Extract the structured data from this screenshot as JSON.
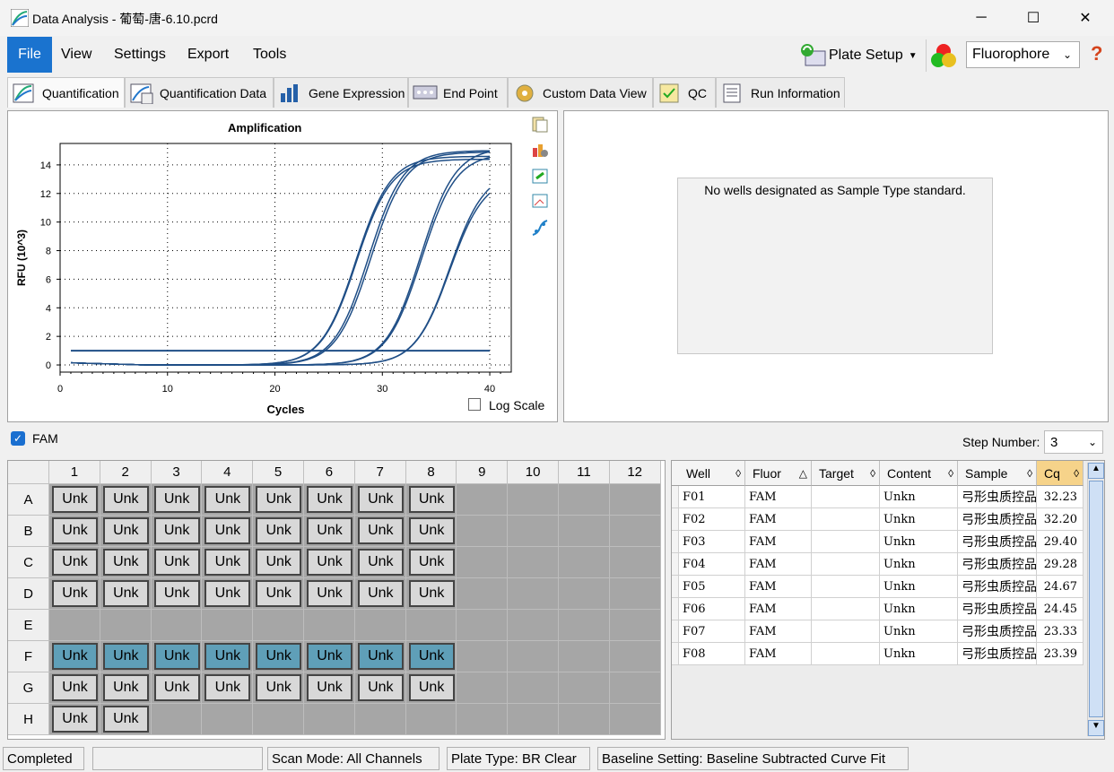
{
  "window": {
    "title": "Data Analysis - 葡萄-唐-6.10.pcrd",
    "minimize": "─",
    "maximize": "☐",
    "close": "✕"
  },
  "menu": {
    "file": "File",
    "view": "View",
    "settings": "Settings",
    "export": "Export",
    "tools": "Tools",
    "plate_setup": "Plate Setup",
    "fluorophore": "Fluorophore",
    "help": "?"
  },
  "tabs": [
    "Quantification",
    "Quantification Data",
    "Gene Expression",
    "End Point",
    "Custom Data View",
    "QC",
    "Run Information"
  ],
  "chart_title": "Amplification",
  "log_scale_label": "Log Scale",
  "standard_message": "No wells designated as Sample Type standard.",
  "fam_label": "FAM",
  "step_number": {
    "label": "Step Number:",
    "value": "3"
  },
  "plate": {
    "columns": [
      "1",
      "2",
      "3",
      "4",
      "5",
      "6",
      "7",
      "8",
      "9",
      "10",
      "11",
      "12"
    ],
    "rows": [
      "A",
      "B",
      "C",
      "D",
      "E",
      "F",
      "G",
      "H"
    ],
    "well_label": "Unk",
    "filled": {
      "A": 8,
      "B": 8,
      "C": 8,
      "D": 8,
      "E": 0,
      "F": 8,
      "G": 8,
      "H": 2
    },
    "selected_row": "F"
  },
  "table": {
    "headers": [
      "Well",
      "Fluor",
      "Target",
      "Content",
      "Sample",
      "Cq"
    ],
    "rows": [
      [
        "F01",
        "FAM",
        "",
        "Unkn",
        "弓形虫质控品",
        "32.23"
      ],
      [
        "F02",
        "FAM",
        "",
        "Unkn",
        "弓形虫质控品",
        "32.20"
      ],
      [
        "F03",
        "FAM",
        "",
        "Unkn",
        "弓形虫质控品",
        "29.40"
      ],
      [
        "F04",
        "FAM",
        "",
        "Unkn",
        "弓形虫质控品",
        "29.28"
      ],
      [
        "F05",
        "FAM",
        "",
        "Unkn",
        "弓形虫质控品",
        "24.67"
      ],
      [
        "F06",
        "FAM",
        "",
        "Unkn",
        "弓形虫质控品",
        "24.45"
      ],
      [
        "F07",
        "FAM",
        "",
        "Unkn",
        "弓形虫质控品",
        "23.33"
      ],
      [
        "F08",
        "FAM",
        "",
        "Unkn",
        "弓形虫质控品",
        "23.39"
      ]
    ]
  },
  "status": {
    "state": "Completed",
    "scan_mode": "Scan Mode: All Channels",
    "plate_type": "Plate Type: BR Clear",
    "baseline": "Baseline Setting: Baseline Subtracted Curve Fit"
  },
  "chart_data": {
    "type": "line",
    "title": "Amplification",
    "xlabel": "Cycles",
    "ylabel": "RFU (10^3)",
    "xlim": [
      0,
      42
    ],
    "ylim": [
      -0.5,
      15.5
    ],
    "xticks": [
      0,
      10,
      20,
      30,
      40
    ],
    "yticks": [
      0,
      2,
      4,
      6,
      8,
      10,
      12,
      14
    ],
    "threshold": 1.0,
    "series": [
      {
        "cq": 23.33,
        "plateau": 14.6
      },
      {
        "cq": 23.39,
        "plateau": 14.4
      },
      {
        "cq": 24.45,
        "plateau": 15.0
      },
      {
        "cq": 24.67,
        "plateau": 14.9
      },
      {
        "cq": 29.28,
        "plateau": 15.2
      },
      {
        "cq": 29.4,
        "plateau": 14.8
      },
      {
        "cq": 32.2,
        "plateau": 13.6
      },
      {
        "cq": 32.23,
        "plateau": 13.2
      }
    ],
    "color": "#1f4e86"
  }
}
